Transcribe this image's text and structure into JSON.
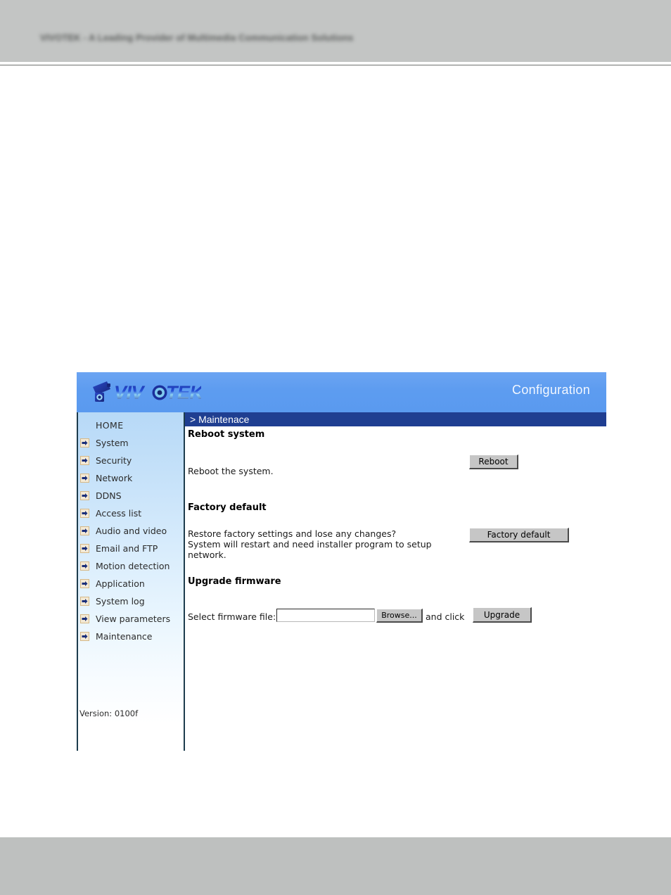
{
  "top_banner": {
    "text": "VIVOTEK - A Leading Provider of Multimedia Communication Solutions"
  },
  "panel": {
    "logo_text": "VIVOTEK",
    "logo_icon": "network-camera-icon",
    "header_title": "Configuration"
  },
  "sidebar": {
    "items": [
      {
        "label": "HOME",
        "icon": "none"
      },
      {
        "label": "System",
        "icon": "arrow-right-icon"
      },
      {
        "label": "Security",
        "icon": "arrow-right-icon"
      },
      {
        "label": "Network",
        "icon": "arrow-right-icon"
      },
      {
        "label": "DDNS",
        "icon": "arrow-right-icon"
      },
      {
        "label": "Access list",
        "icon": "arrow-right-icon"
      },
      {
        "label": "Audio and video",
        "icon": "arrow-right-icon"
      },
      {
        "label": "Email and FTP",
        "icon": "arrow-right-icon"
      },
      {
        "label": "Motion detection",
        "icon": "arrow-right-icon"
      },
      {
        "label": "Application",
        "icon": "arrow-right-icon"
      },
      {
        "label": "System log",
        "icon": "arrow-right-icon"
      },
      {
        "label": "View parameters",
        "icon": "arrow-right-icon"
      },
      {
        "label": "Maintenance",
        "icon": "arrow-right-icon"
      }
    ],
    "version": "Version: 0100f"
  },
  "content": {
    "title": "> Maintenace",
    "reboot": {
      "heading": "Reboot system",
      "description": "Reboot the system.",
      "button": "Reboot"
    },
    "factory": {
      "heading": "Factory default",
      "description": "Restore factory settings and lose any changes?\nSystem will restart and need installer program to setup\nnetwork.",
      "button": "Factory default"
    },
    "upgrade": {
      "heading": "Upgrade firmware",
      "label": "Select firmware file:",
      "file_value": "",
      "browse_button": "Browse...",
      "middle_text": "and click",
      "upgrade_button": "Upgrade"
    }
  },
  "colors": {
    "header_blue": "#5d9cf0",
    "title_bar_navy": "#1f3e91",
    "sidebar_top": "#b7d9f7",
    "banner_gray": "#c3c5c4",
    "button_face": "#c6c6c6"
  }
}
